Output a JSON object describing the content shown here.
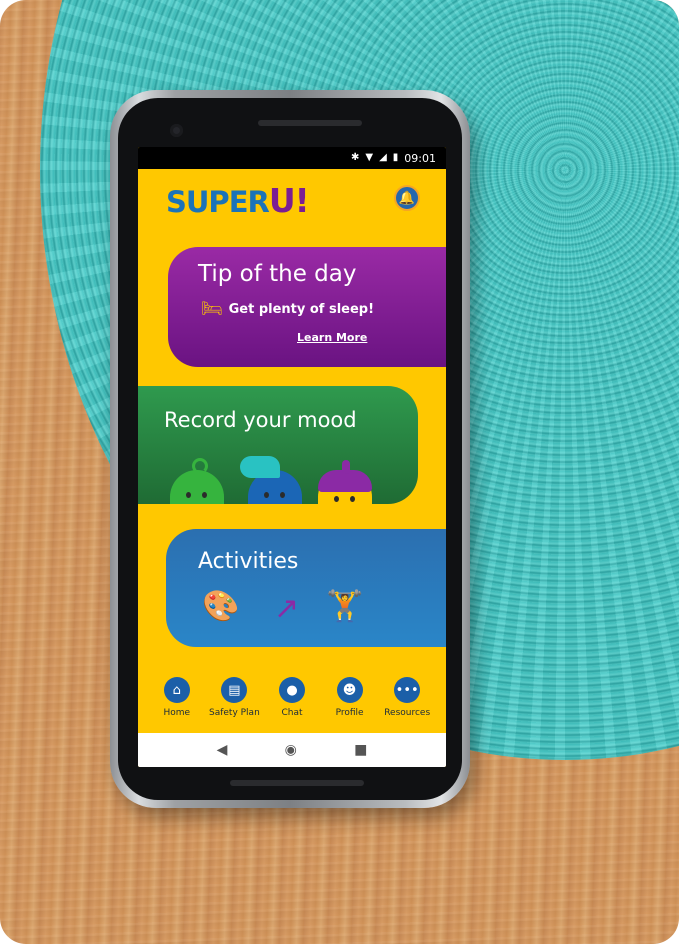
{
  "status_bar": {
    "time": "09:01",
    "icons": [
      "bluetooth-icon",
      "wifi-icon",
      "signal-icon",
      "battery-icon"
    ]
  },
  "app": {
    "logo_part1": "SUPER",
    "logo_part2": "U!"
  },
  "tip_card": {
    "title": "Tip of the day",
    "tip_text": "Get plenty of sleep!",
    "link": "Learn More"
  },
  "mood_card": {
    "title": "Record your mood"
  },
  "activities_card": {
    "title": "Activities"
  },
  "bottom_nav": {
    "items": [
      {
        "label": "Home",
        "icon": "home-icon"
      },
      {
        "label": "Safety Plan",
        "icon": "clipboard-icon"
      },
      {
        "label": "Chat",
        "icon": "chat-icon"
      },
      {
        "label": "Profile",
        "icon": "profile-icon"
      },
      {
        "label": "Resources",
        "icon": "more-icon"
      }
    ]
  },
  "colors": {
    "screen_bg": "#ffc800",
    "tip_card": "#8b2aa5",
    "mood_card": "#2a8a45",
    "activities_card": "#2a78bd",
    "nav_icon": "#1b5fa8"
  }
}
